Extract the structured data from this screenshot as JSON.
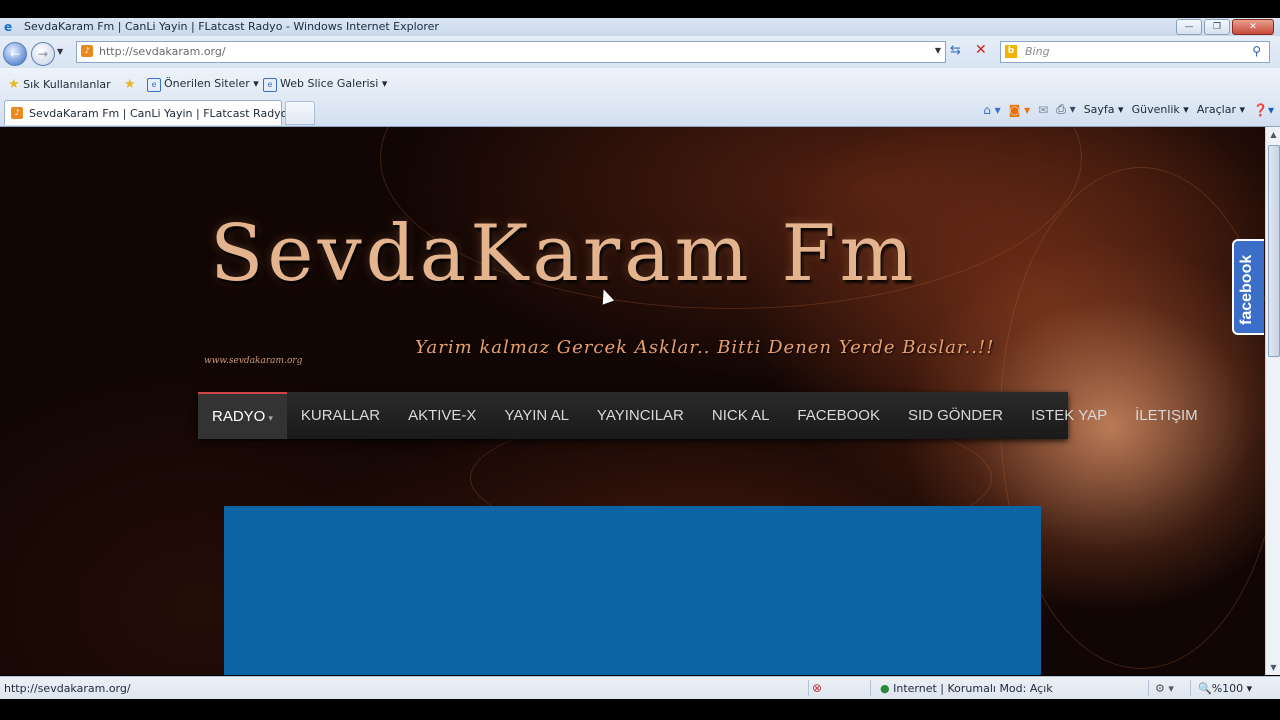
{
  "window": {
    "title": "SevdaKaram Fm | CanLi Yayin | FLatcast Radyo - Windows Internet Explorer",
    "buttons": {
      "minimize": "—",
      "maximize": "❐",
      "close": "✕"
    }
  },
  "address": {
    "url": "http://sevdakaram.org/",
    "search_placeholder": "Bing"
  },
  "favorites": {
    "favorites_label": "Sık Kullanılanlar",
    "suggested_sites": "Önerilen Siteler",
    "web_slice_gallery": "Web Slice Galerisi"
  },
  "tabs": [
    {
      "label": "SevdaKaram Fm | CanLi Yayin | FLatcast Radyo"
    }
  ],
  "commandbar": {
    "page": "Sayfa",
    "safety": "Güvenlik",
    "tools": "Araçlar"
  },
  "site": {
    "logo_part1": "Sevda",
    "logo_part2": "Karam",
    "logo_part3": "Fm",
    "slogan": "Yarim kalmaz Gercek Asklar.. Bitti Denen Yerde Baslar..!!",
    "site_url": "www.sevdakaram.org",
    "menu": [
      "RADYO",
      "KURALLAR",
      "AKTIVE-X",
      "YAYIN AL",
      "YAYINCILAR",
      "NICK AL",
      "FACEBOOK",
      "SID GÖNDER",
      "ISTEK YAP",
      "İLETIŞIM"
    ],
    "facebook_tab": "facebook"
  },
  "status": {
    "text": "http://sevdakaram.org/",
    "zone": "Internet | Korumalı Mod: Açık",
    "zoom": "%100"
  },
  "colors": {
    "menu_bg": "#222222",
    "content_box": "#0d64a5",
    "facebook_blue": "#3b6ec8"
  }
}
